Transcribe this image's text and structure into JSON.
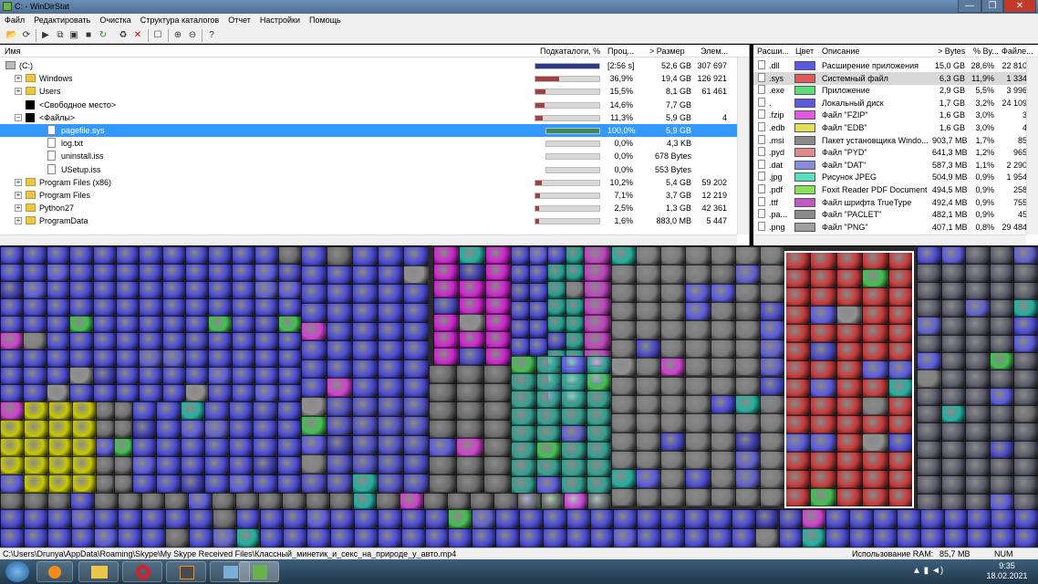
{
  "window": {
    "title": "C: - WinDirStat",
    "minimize": "—",
    "maximize": "❐",
    "close": "✕"
  },
  "menu": [
    "Файл",
    "Редактировать",
    "Очистка",
    "Структура каталогов",
    "Отчет",
    "Настройки",
    "Помощь"
  ],
  "tree": {
    "headers": {
      "name": "Имя",
      "subdirs": "Подкаталоги, %",
      "percent": "Проц...",
      "size": "> Размер",
      "items": "Элем..."
    },
    "rows": [
      {
        "name": "(C:)",
        "percent": "[2:56 s]",
        "size": "52,6 GB",
        "items": "307 697",
        "bar": 1.0,
        "barColor": "#2a3a8a",
        "icon": "drive",
        "indent": 0,
        "expander": ""
      },
      {
        "name": "Windows",
        "percent": "36,9%",
        "size": "19,4 GB",
        "items": "126 921",
        "bar": 0.369,
        "barColor": "#a04040",
        "icon": "folder",
        "indent": 1,
        "expander": "+"
      },
      {
        "name": "Users",
        "percent": "15,5%",
        "size": "8,1 GB",
        "items": "61 461",
        "bar": 0.155,
        "barColor": "#a04040",
        "icon": "folder",
        "indent": 1,
        "expander": "+"
      },
      {
        "name": "<Свободное место>",
        "percent": "14,6%",
        "size": "7,7 GB",
        "items": "",
        "bar": 0.146,
        "barColor": "#a04040",
        "icon": "black",
        "indent": 1,
        "expander": ""
      },
      {
        "name": "<Файлы>",
        "percent": "11,3%",
        "size": "5,9 GB",
        "items": "4",
        "bar": 0.113,
        "barColor": "#a04040",
        "icon": "black",
        "indent": 1,
        "expander": "−"
      },
      {
        "name": "pagefile.sys",
        "percent": "100,0%",
        "size": "5,9 GB",
        "items": "",
        "bar": 1.0,
        "barColor": "#3a8a5a",
        "icon": "file",
        "indent": 2,
        "expander": "",
        "selected": true
      },
      {
        "name": "log.txt",
        "percent": "0,0%",
        "size": "4,3 KB",
        "items": "",
        "bar": 0.0,
        "barColor": "#3a8a5a",
        "icon": "file",
        "indent": 2,
        "expander": ""
      },
      {
        "name": "uninstall.iss",
        "percent": "0,0%",
        "size": "678 Bytes",
        "items": "",
        "bar": 0.0,
        "barColor": "#3a8a5a",
        "icon": "file",
        "indent": 2,
        "expander": ""
      },
      {
        "name": "USetup.iss",
        "percent": "0,0%",
        "size": "553 Bytes",
        "items": "",
        "bar": 0.0,
        "barColor": "#3a8a5a",
        "icon": "file",
        "indent": 2,
        "expander": ""
      },
      {
        "name": "Program Files (x86)",
        "percent": "10,2%",
        "size": "5,4 GB",
        "items": "59 202",
        "bar": 0.102,
        "barColor": "#a04040",
        "icon": "folder",
        "indent": 1,
        "expander": "+"
      },
      {
        "name": "Program Files",
        "percent": "7,1%",
        "size": "3,7 GB",
        "items": "12 219",
        "bar": 0.071,
        "barColor": "#a04040",
        "icon": "folder",
        "indent": 1,
        "expander": "+"
      },
      {
        "name": "Python27",
        "percent": "2,5%",
        "size": "1,3 GB",
        "items": "42 361",
        "bar": 0.025,
        "barColor": "#a04040",
        "icon": "folder",
        "indent": 1,
        "expander": "+"
      },
      {
        "name": "ProgramData",
        "percent": "1,6%",
        "size": "883,0 MB",
        "items": "5 447",
        "bar": 0.016,
        "barColor": "#a04040",
        "icon": "folder",
        "indent": 1,
        "expander": "+"
      }
    ]
  },
  "ext": {
    "headers": {
      "ext": "Расши...",
      "color": "Цвет",
      "desc": "Описание",
      "bytes": "> Bytes",
      "pct": "% By...",
      "files": "Файле..."
    },
    "rows": [
      {
        "ext": ".dll",
        "color": "#5a5ae0",
        "desc": "Расширение приложения",
        "bytes": "15,0 GB",
        "pct": "28,6%",
        "files": "22 810"
      },
      {
        "ext": ".sys",
        "color": "#e05a5a",
        "desc": "Системный файл",
        "bytes": "6,3 GB",
        "pct": "11,9%",
        "files": "1 334",
        "selected": true
      },
      {
        "ext": ".exe",
        "color": "#5ae07a",
        "desc": "Приложение",
        "bytes": "2,9 GB",
        "pct": "5,5%",
        "files": "3 996"
      },
      {
        "ext": ".",
        "color": "#5a5ae0",
        "desc": "Локальный диск",
        "bytes": "1,7 GB",
        "pct": "3,2%",
        "files": "24 109"
      },
      {
        "ext": ".fzip",
        "color": "#e05ae0",
        "desc": "Файл \"FZIP\"",
        "bytes": "1,6 GB",
        "pct": "3,0%",
        "files": "3"
      },
      {
        "ext": ".edb",
        "color": "#e0e05a",
        "desc": "Файл \"EDB\"",
        "bytes": "1,6 GB",
        "pct": "3,0%",
        "files": "4"
      },
      {
        "ext": ".msi",
        "color": "#8a8a8a",
        "desc": "Пакет установщика Windo...",
        "bytes": "903,7 MB",
        "pct": "1,7%",
        "files": "85"
      },
      {
        "ext": ".pyd",
        "color": "#e08a8a",
        "desc": "Файл \"PYD\"",
        "bytes": "641,3 MB",
        "pct": "1,2%",
        "files": "965"
      },
      {
        "ext": ".dat",
        "color": "#8a8ae0",
        "desc": "Файл \"DAT\"",
        "bytes": "587,3 MB",
        "pct": "1,1%",
        "files": "2 290"
      },
      {
        "ext": ".jpg",
        "color": "#5ae0c0",
        "desc": "Рисунок JPEG",
        "bytes": "504,9 MB",
        "pct": "0,9%",
        "files": "1 954"
      },
      {
        "ext": ".pdf",
        "color": "#8ae05a",
        "desc": "Foxit Reader PDF Document",
        "bytes": "494,5 MB",
        "pct": "0,9%",
        "files": "258"
      },
      {
        "ext": ".ttf",
        "color": "#c05ac0",
        "desc": "Файл шрифта TrueType",
        "bytes": "492,4 MB",
        "pct": "0,9%",
        "files": "755"
      },
      {
        "ext": ".pa...",
        "color": "#8a8a8a",
        "desc": "Файл \"PACLET\"",
        "bytes": "482,1 MB",
        "pct": "0,9%",
        "files": "45"
      },
      {
        "ext": ".png",
        "color": "#a0a0a0",
        "desc": "Файл \"PNG\"",
        "bytes": "407,1 MB",
        "pct": "0,8%",
        "files": "29 484"
      }
    ]
  },
  "status": {
    "path": "C:\\Users\\Drunya\\AppData\\Roaming\\Skype\\My Skype Received Files\\Классный_минетик_и_секс_на_природе_у_авто.mp4",
    "ram_label": "Использование RAM:",
    "ram_value": "85,7 MB",
    "num": "NUM"
  },
  "clock": {
    "time": "9:35",
    "date": "18.02.2021"
  }
}
